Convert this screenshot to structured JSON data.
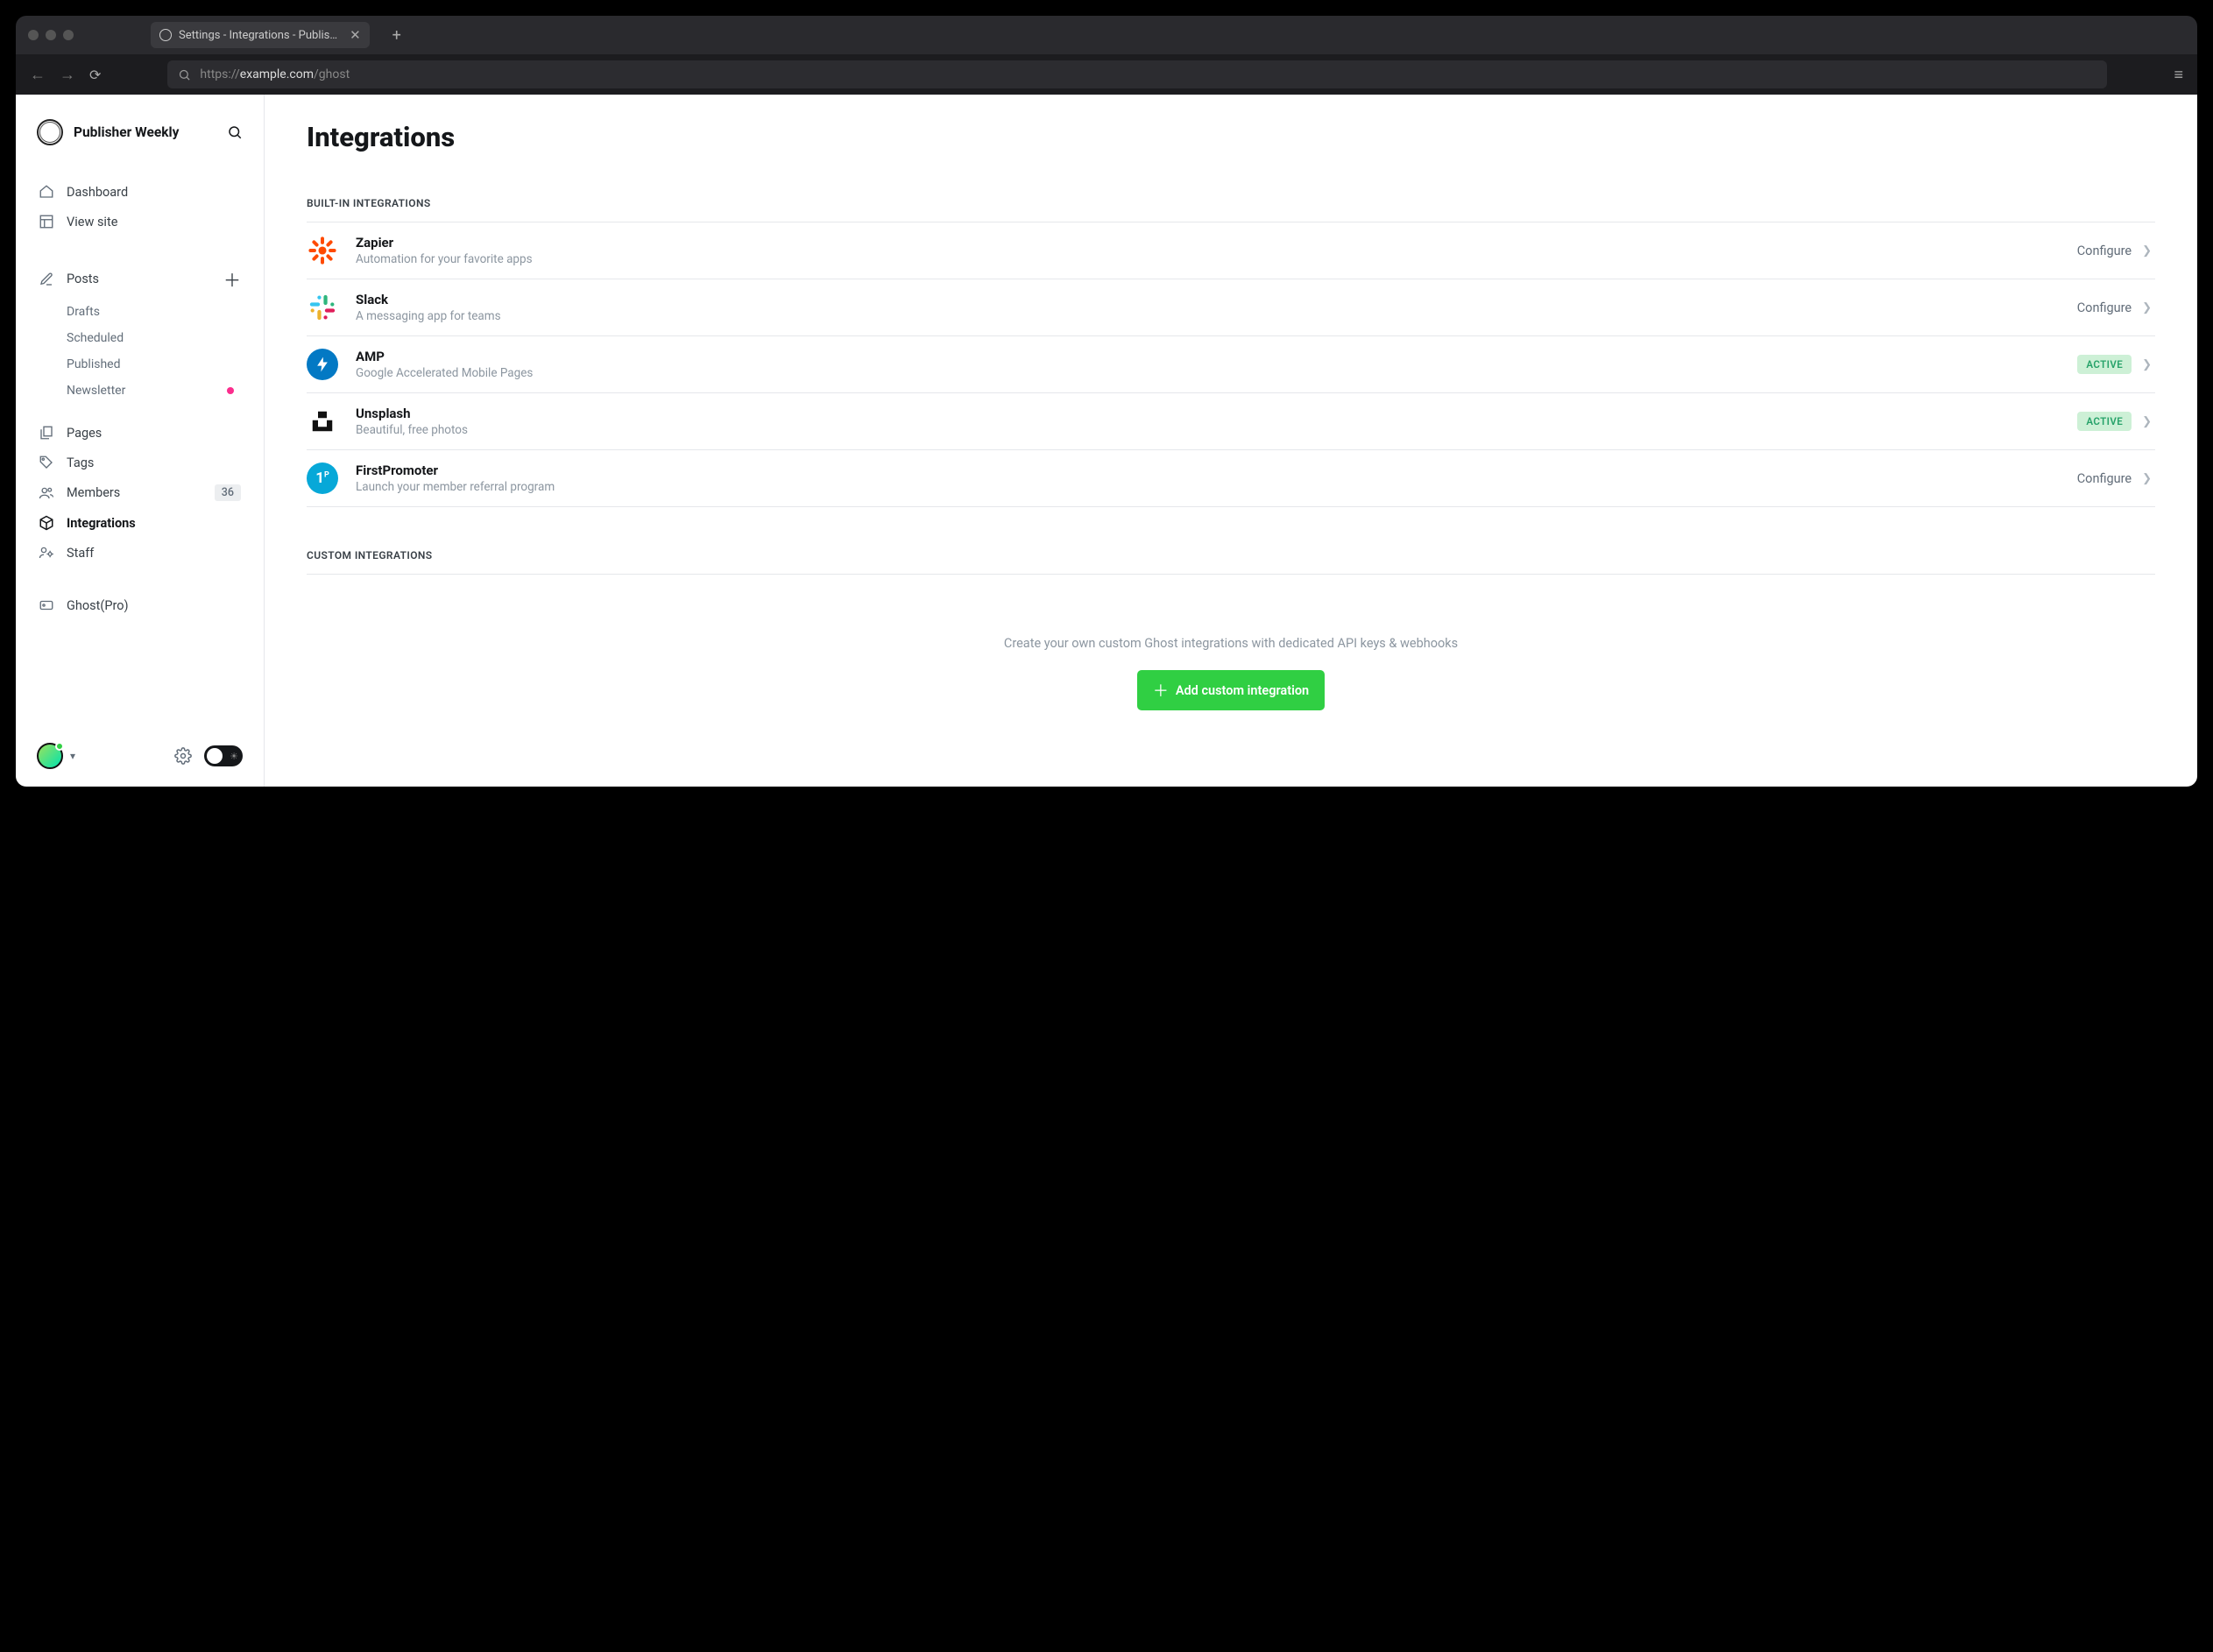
{
  "browser": {
    "tab_title": "Settings - Integrations - Publis…",
    "url_prefix": "https://",
    "url_host": "example.com",
    "url_path": "/ghost"
  },
  "sidebar": {
    "brand": "Publisher Weekly",
    "nav": {
      "dashboard": "Dashboard",
      "view_site": "View site",
      "posts": "Posts",
      "drafts": "Drafts",
      "scheduled": "Scheduled",
      "published": "Published",
      "newsletter": "Newsletter",
      "pages": "Pages",
      "tags": "Tags",
      "members": "Members",
      "members_count": "36",
      "integrations": "Integrations",
      "staff": "Staff",
      "ghost_pro": "Ghost(Pro)"
    }
  },
  "main": {
    "title": "Integrations",
    "builtin_label": "Built-in integrations",
    "custom_label": "Custom integrations",
    "configure": "Configure",
    "active": "ACTIVE",
    "integrations": [
      {
        "name": "Zapier",
        "desc": "Automation for your favorite apps",
        "status": "configure"
      },
      {
        "name": "Slack",
        "desc": "A messaging app for teams",
        "status": "configure"
      },
      {
        "name": "AMP",
        "desc": "Google Accelerated Mobile Pages",
        "status": "active"
      },
      {
        "name": "Unsplash",
        "desc": "Beautiful, free photos",
        "status": "active"
      },
      {
        "name": "FirstPromoter",
        "desc": "Launch your member referral program",
        "status": "configure"
      }
    ],
    "custom_empty_desc": "Create your own custom Ghost integrations with dedicated API keys & webhooks",
    "add_button": "Add custom integration"
  }
}
